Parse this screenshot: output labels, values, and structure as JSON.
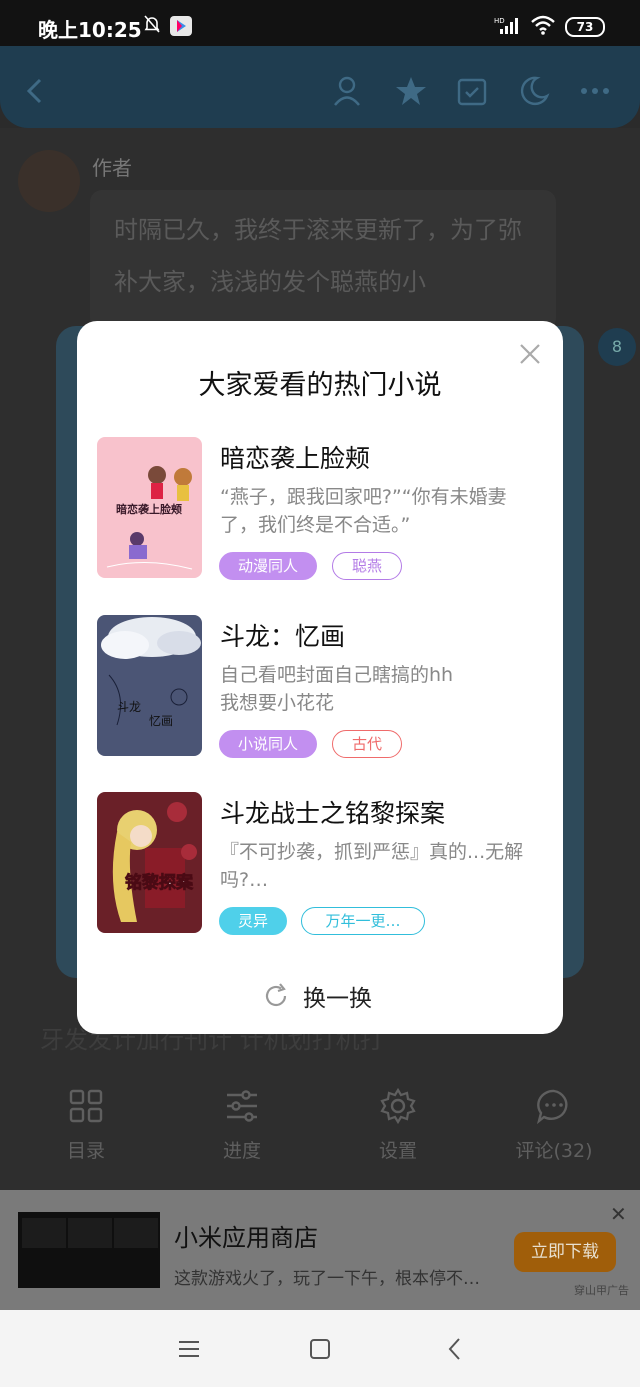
{
  "status_bar": {
    "time": "晚上10:25",
    "battery": "73"
  },
  "background": {
    "author_label": "作者",
    "message": "时隔已久，我终于滚来更新了，为了弥补大家，浅浅的发个聪燕的小",
    "side_badge": "8",
    "lower_text": "牙发发计加行刊计 计机划打机打"
  },
  "toolbar": {
    "items": [
      {
        "label": "目录",
        "icon": "grid-icon"
      },
      {
        "label": "进度",
        "icon": "sliders-icon"
      },
      {
        "label": "设置",
        "icon": "gear-icon"
      },
      {
        "label": "评论(32)",
        "icon": "comment-icon"
      }
    ]
  },
  "ad": {
    "title": "小米应用商店",
    "description": "这款游戏火了，玩了一下午，根本停不…",
    "button": "立即下载",
    "tag": "穿山甲广告",
    "close": "✕"
  },
  "modal": {
    "title": "大家爱看的热门小说",
    "refresh_label": "换一换",
    "books": [
      {
        "title": "暗恋袭上脸颊",
        "description": "“燕子，跟我回家吧?”“你有未婚妻了，我们终是不合适。”",
        "cover_text": "暗恋袭上脸颊",
        "cover_color": "#f7b8c4",
        "tags": [
          {
            "label": "动漫同人",
            "style": "filled-purple"
          },
          {
            "label": "聪燕",
            "style": "outline-purple"
          }
        ]
      },
      {
        "title": "斗龙：忆画",
        "description": "自己看吧封面自己瞎搞的hh\n我想要小花花",
        "cover_text_left": "斗龙",
        "cover_text_right": "忆画",
        "cover_color": "#4a5470",
        "tags": [
          {
            "label": "小说同人",
            "style": "filled-purple"
          },
          {
            "label": "古代",
            "style": "outline-red"
          }
        ]
      },
      {
        "title": "斗龙战士之铭黎探案",
        "description": "『不可抄袭，抓到严惩』真的...无解吗?…",
        "cover_text": "铭黎探案",
        "cover_color": "#7a2a30",
        "tags": [
          {
            "label": "灵异",
            "style": "filled-cyan"
          },
          {
            "label": "万年一更…",
            "style": "outline-cyan"
          }
        ]
      }
    ]
  }
}
